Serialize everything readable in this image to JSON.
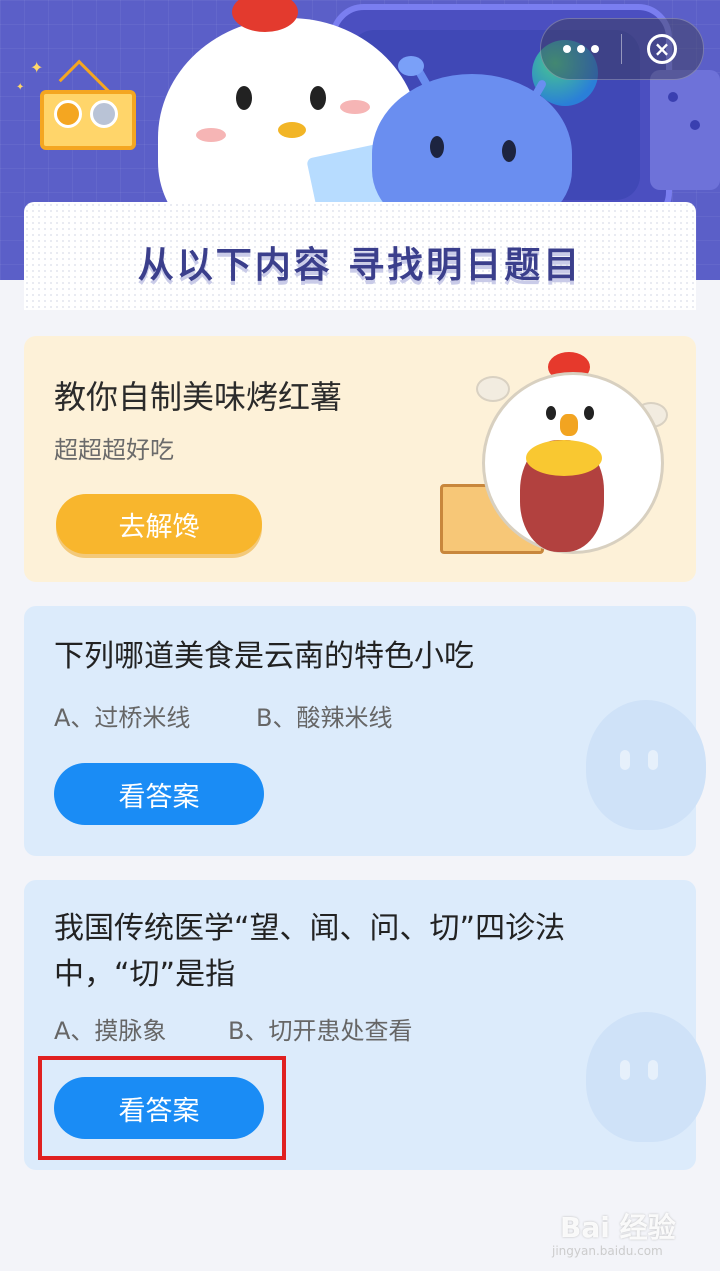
{
  "header": {
    "title": "从以下内容 寻找明日题目",
    "capsule_more_icon": "more-dots-icon",
    "capsule_close_icon": "close-circle-icon"
  },
  "food_card": {
    "title": "教你自制美味烤红薯",
    "subtitle": "超超超好吃",
    "button_label": "去解馋"
  },
  "questions": [
    {
      "title": "下列哪道美食是云南的特色小吃",
      "option_a": "A、过桥米线",
      "option_b": "B、酸辣米线",
      "button_label": "看答案"
    },
    {
      "title": "我国传统医学“望、闻、问、切”四诊法中，“切”是指",
      "option_a": "A、摸脉象",
      "option_b": "B、切开患处查看",
      "button_label": "看答案"
    }
  ],
  "watermark": {
    "text": "Bai 经验",
    "sub": "jingyan.baidu.com"
  },
  "colors": {
    "banner": "#5b5fc8",
    "title": "#3b3f8c",
    "primary_button": "#1a8cf5",
    "orange_button": "#f8b62d",
    "food_card_bg": "#fdf1d8",
    "question_card_bg": "#dcebfb",
    "highlight": "#e02020"
  }
}
